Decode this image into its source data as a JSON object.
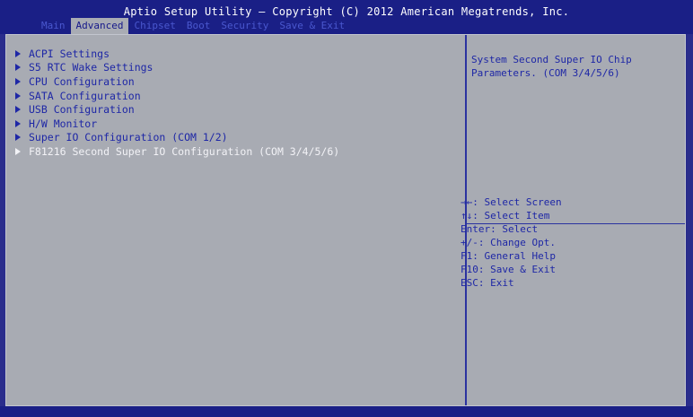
{
  "header": {
    "title": "Aptio Setup Utility – Copyright (C) 2012 American Megatrends, Inc."
  },
  "tabs": [
    {
      "label": "Main",
      "active": false
    },
    {
      "label": "Advanced",
      "active": true
    },
    {
      "label": "Chipset",
      "active": false
    },
    {
      "label": "Boot",
      "active": false
    },
    {
      "label": "Security",
      "active": false
    },
    {
      "label": "Save & Exit",
      "active": false
    }
  ],
  "menu": {
    "items": [
      {
        "label": "ACPI Settings"
      },
      {
        "label": "S5 RTC Wake Settings"
      },
      {
        "label": "CPU Configuration"
      },
      {
        "label": "SATA Configuration"
      },
      {
        "label": "USB Configuration"
      },
      {
        "label": "H/W Monitor"
      },
      {
        "label": "Super IO Configuration (COM 1/2)"
      },
      {
        "label": "F81216 Second Super IO Configuration (COM 3/4/5/6)"
      }
    ],
    "selected_index": 7
  },
  "help": {
    "text": "System Second Super IO Chip\nParameters. (COM 3/4/5/6)"
  },
  "keys": [
    {
      "text": "→←: Select Screen"
    },
    {
      "text": "↑↓: Select Item"
    },
    {
      "text": "Enter: Select"
    },
    {
      "text": "+/-: Change Opt."
    },
    {
      "text": "F1: General Help"
    },
    {
      "text": "F10: Save & Exit"
    },
    {
      "text": "ESC: Exit"
    }
  ],
  "colors": {
    "frame_blue": "#2a2d8c",
    "panel_grey": "#a8abb3",
    "text_blue": "#1e27a6",
    "highlight_white": "#f2f2f6"
  }
}
